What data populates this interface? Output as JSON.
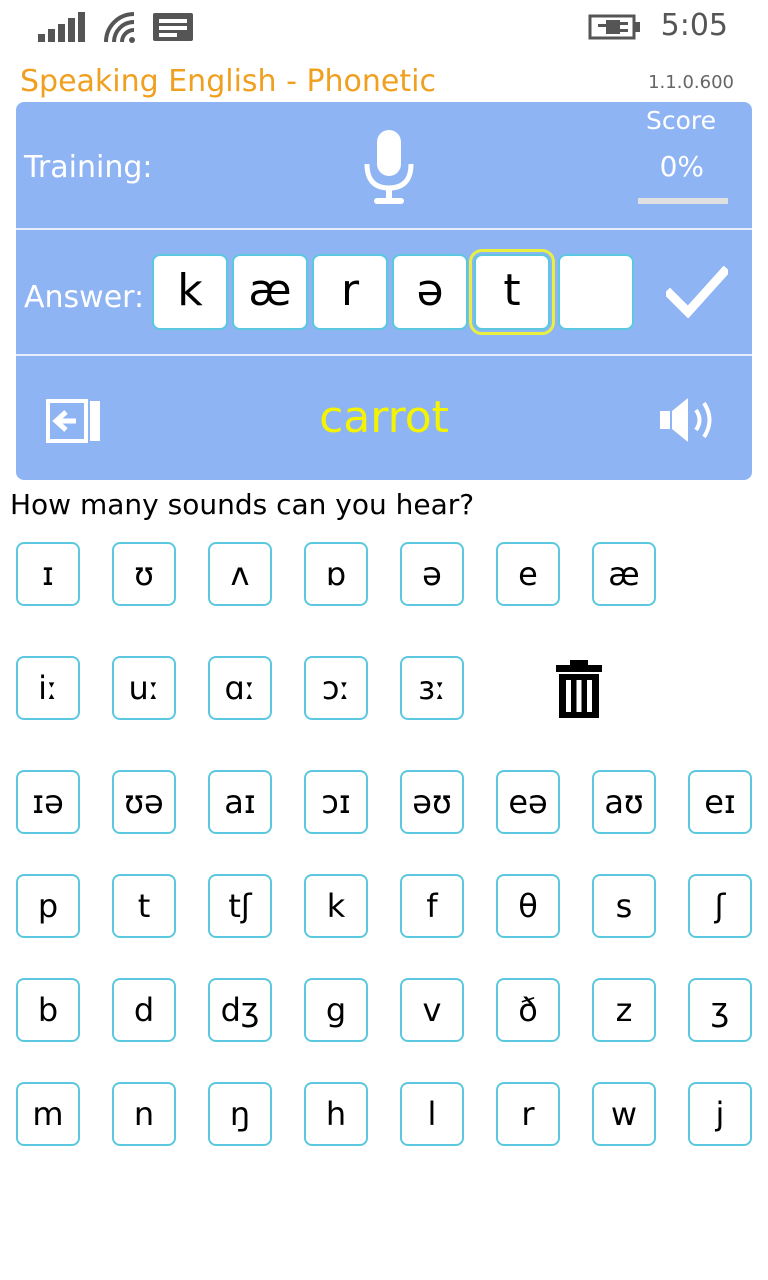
{
  "status": {
    "time": "5:05"
  },
  "header": {
    "title": "Speaking English - Phonetic",
    "version": "1.1.0.600"
  },
  "training": {
    "label": "Training:",
    "score_title": "Score",
    "score_value": "0%",
    "score_progress": 0
  },
  "answer": {
    "label": "Answer:",
    "slots": [
      "k",
      "æ",
      "r",
      "ə",
      "t",
      ""
    ],
    "selected_index": 4
  },
  "word": "carrot",
  "question": "How many sounds can you hear?",
  "keyboard": {
    "rows": [
      [
        "ɪ",
        "ʊ",
        "ʌ",
        "ɒ",
        "ə",
        "e",
        "æ"
      ],
      [
        "iː",
        "uː",
        "ɑː",
        "ɔː",
        "ɜː"
      ],
      [
        "ɪə",
        "ʊə",
        "aɪ",
        "ɔɪ",
        "əʊ",
        "eə",
        "aʊ",
        "eɪ"
      ],
      [
        "p",
        "t",
        "tʃ",
        "k",
        "f",
        "θ",
        "s",
        "ʃ"
      ],
      [
        "b",
        "d",
        "dʒ",
        "g",
        "v",
        "ð",
        "z",
        "ʒ"
      ],
      [
        "m",
        "n",
        "ŋ",
        "h",
        "l",
        "r",
        "w",
        "j"
      ]
    ]
  },
  "icons": {
    "signal": "signal-icon",
    "wifi": "wifi-icon",
    "message": "message-icon",
    "battery": "battery-charging-icon",
    "mic": "microphone-icon",
    "check": "checkmark-icon",
    "back": "back-icon",
    "speaker": "speaker-icon",
    "delete": "trash-icon"
  },
  "colors": {
    "accent": "#f0a020",
    "panel": "#8fb4f4",
    "word": "#f4f400",
    "key_border": "#5cc8e0",
    "selected": "#e8f040"
  }
}
